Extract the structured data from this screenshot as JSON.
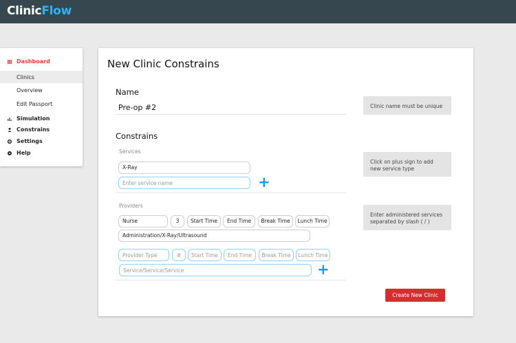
{
  "app": {
    "brand_part1": "Clinic",
    "brand_part2": "Flow",
    "accent_color": "#29b6f6",
    "topbar_color": "#37474f"
  },
  "sidebar": {
    "dashboard": {
      "label": "Dashboard",
      "icon": "dashboard-grid-icon"
    },
    "items": [
      {
        "label": "Clinics",
        "active": true
      },
      {
        "label": "Overview"
      },
      {
        "label": "Edit Passport"
      }
    ],
    "simulation": {
      "label": "Simulation",
      "icon": "bar-chart-icon"
    },
    "constrains": {
      "label": "Constrains",
      "icon": "person-icon"
    },
    "settings": {
      "label": "Settings",
      "icon": "gear-icon"
    },
    "help": {
      "label": "Help",
      "icon": "help-icon"
    }
  },
  "page": {
    "title": "New Clinic Constrains",
    "name_section": {
      "title": "Name",
      "value": "Pre-op #2",
      "hint": "Clinic name must be unique"
    },
    "constrains_section": {
      "title": "Constrains",
      "services": {
        "label": "Services",
        "items": [
          "X-Ray"
        ],
        "new_placeholder": "Enter service name",
        "hint": "Click on plus sign to add new service type",
        "add_icon": "plus-icon"
      },
      "providers": {
        "label": "Providers",
        "row": {
          "type": "Nurse",
          "count": "3",
          "start": "Start Time",
          "end": "End Time",
          "break": "Break Time",
          "lunch": "Lunch Time",
          "services": "Administration/X-Ray/Ultrasound"
        },
        "new_row": {
          "type": "Provider Type",
          "count": "#",
          "start": "Start Time",
          "end": "End Time",
          "break": "Break Time",
          "lunch": "Lunch Time",
          "services": "Service/Service/Service"
        },
        "hint": "Enter administered services separated by slash ( / )",
        "add_icon": "plus-icon"
      }
    },
    "create_button": "Create New Clinic",
    "button_color": "#d32f2f"
  }
}
